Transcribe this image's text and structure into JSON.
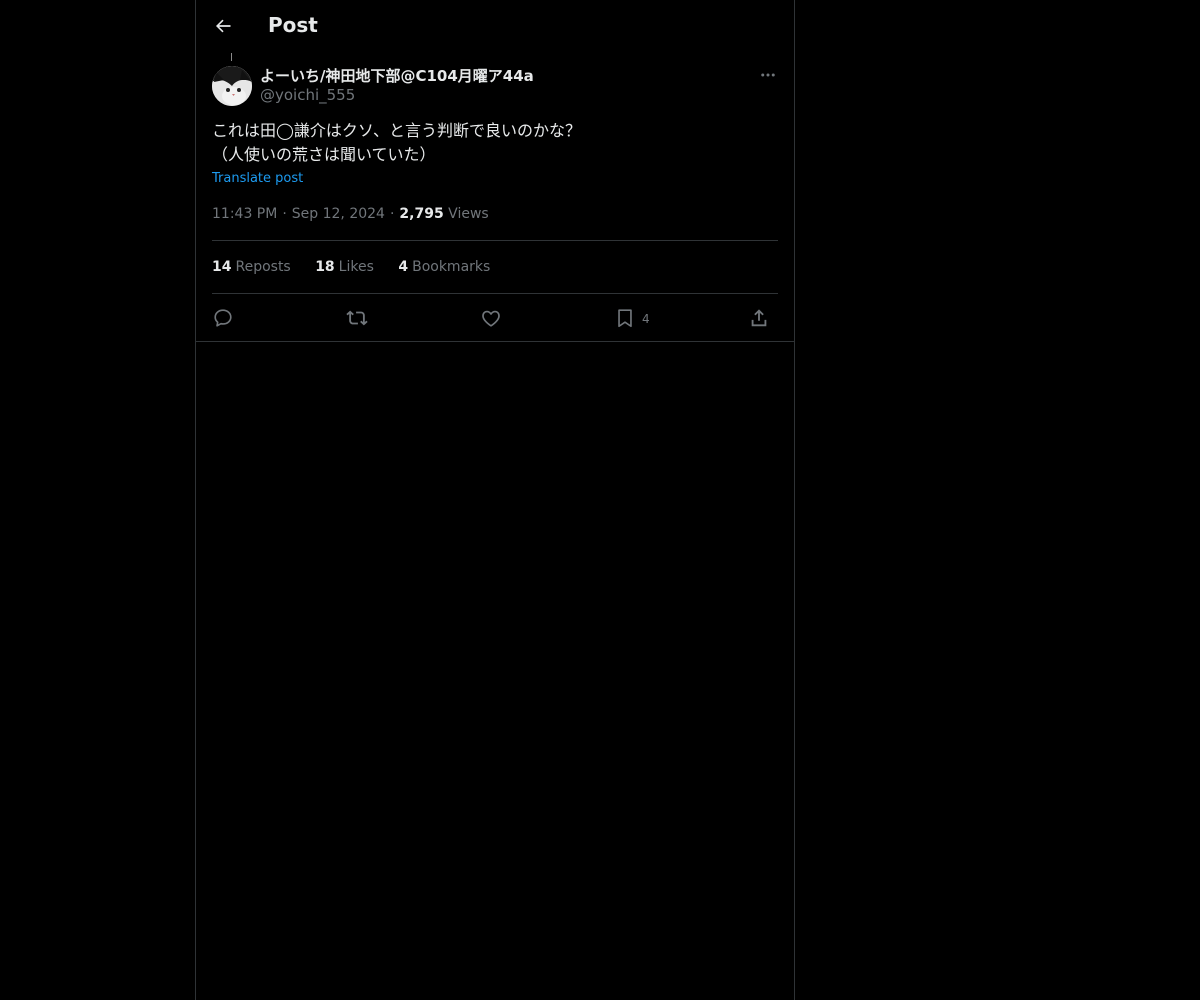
{
  "header": {
    "title": "Post",
    "back_icon": "arrow-left-icon"
  },
  "post": {
    "author": {
      "display_name": "よーいち/神田地下部@C104月曜ア44a",
      "handle": "@yoichi_555",
      "avatar": "cat-avatar"
    },
    "text_lines": [
      "これは田◯謙介はクソ、と言う判断で良いのかな？",
      "（人使いの荒さは聞いていた）"
    ],
    "translate_label": "Translate post",
    "time": "11:43 PM",
    "date": "Sep 12, 2024",
    "views_count": "2,795",
    "views_label": "Views",
    "separator": "·"
  },
  "stats": {
    "reposts_count": "14",
    "reposts_label": "Reposts",
    "likes_count": "18",
    "likes_label": "Likes",
    "bookmarks_count": "4",
    "bookmarks_label": "Bookmarks"
  },
  "actions": {
    "reply_icon": "reply-icon",
    "repost_icon": "repost-icon",
    "like_icon": "heart-icon",
    "bookmark_icon": "bookmark-icon",
    "bookmark_count": "4",
    "share_icon": "share-icon"
  },
  "colors": {
    "background": "#000000",
    "text": "#e7e9ea",
    "muted": "#71767b",
    "accent": "#1d9bf0",
    "border": "#2f3336"
  }
}
